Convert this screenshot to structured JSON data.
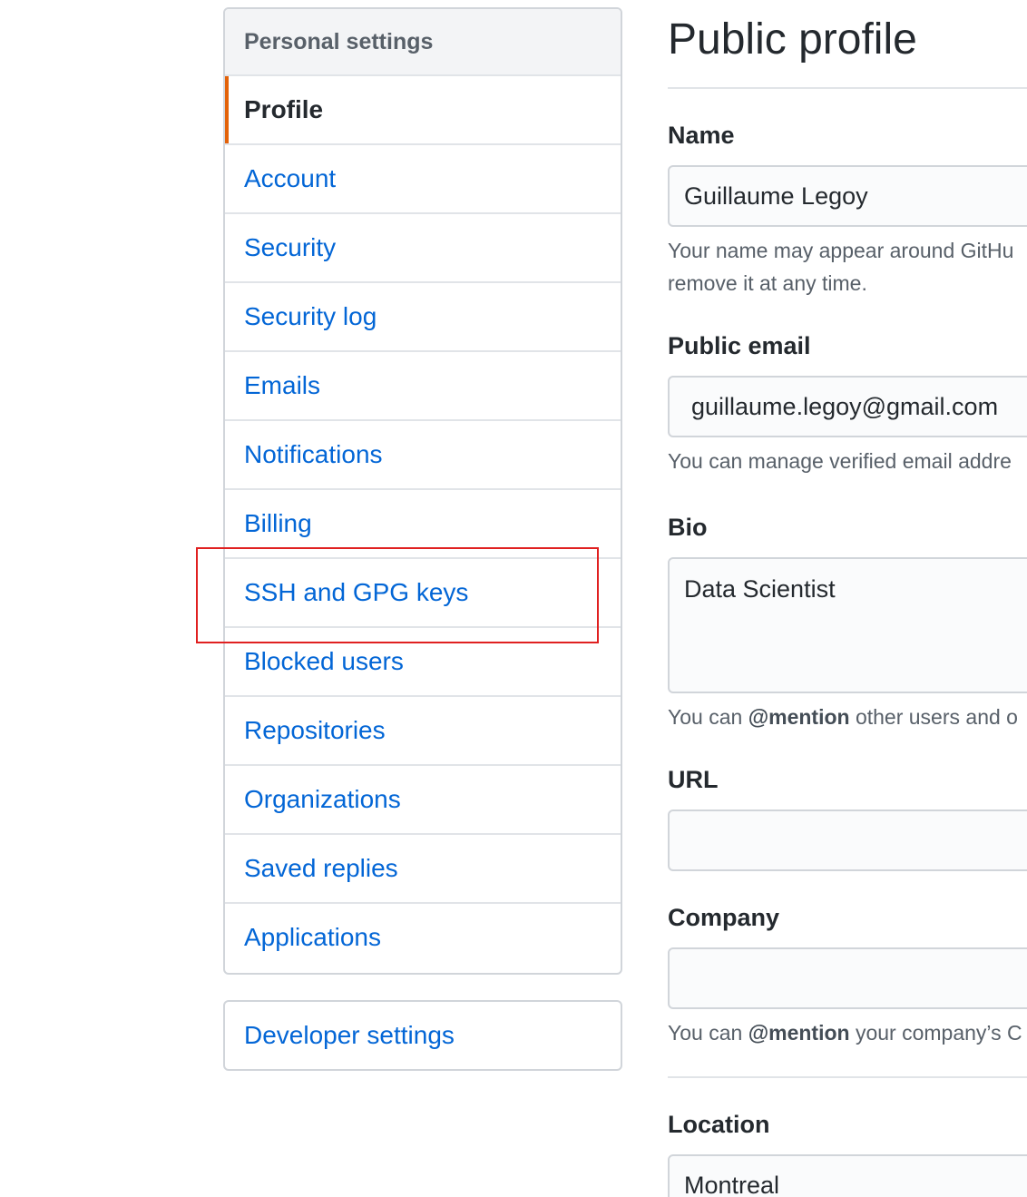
{
  "sidebar": {
    "heading": "Personal settings",
    "items": [
      {
        "label": "Profile"
      },
      {
        "label": "Account"
      },
      {
        "label": "Security"
      },
      {
        "label": "Security log"
      },
      {
        "label": "Emails"
      },
      {
        "label": "Notifications"
      },
      {
        "label": "Billing"
      },
      {
        "label": "SSH and GPG keys"
      },
      {
        "label": "Blocked users"
      },
      {
        "label": "Repositories"
      },
      {
        "label": "Organizations"
      },
      {
        "label": "Saved replies"
      },
      {
        "label": "Applications"
      }
    ],
    "selected": "Profile",
    "developer_settings": "Developer settings"
  },
  "main": {
    "title": "Public profile",
    "name": {
      "label": "Name",
      "value": "Guillaume Legoy",
      "note_line1": "Your name may appear around GitHu",
      "note_line2": "remove it at any time."
    },
    "public_email": {
      "label": "Public email",
      "value": "guillaume.legoy@gmail.com",
      "note": "You can manage verified email addre"
    },
    "bio": {
      "label": "Bio",
      "value": "Data Scientist",
      "note_prefix": "You can ",
      "note_mention": "@mention",
      "note_suffix": " other users and o"
    },
    "url": {
      "label": "URL",
      "value": ""
    },
    "company": {
      "label": "Company",
      "value": "",
      "note_prefix": "You can ",
      "note_mention": "@mention",
      "note_suffix": " your company’s C"
    },
    "location": {
      "label": "Location",
      "value": "Montreal"
    }
  },
  "colors": {
    "link": "#0366d6",
    "selected_accent": "#e36209",
    "highlight_box": "#e02020"
  }
}
